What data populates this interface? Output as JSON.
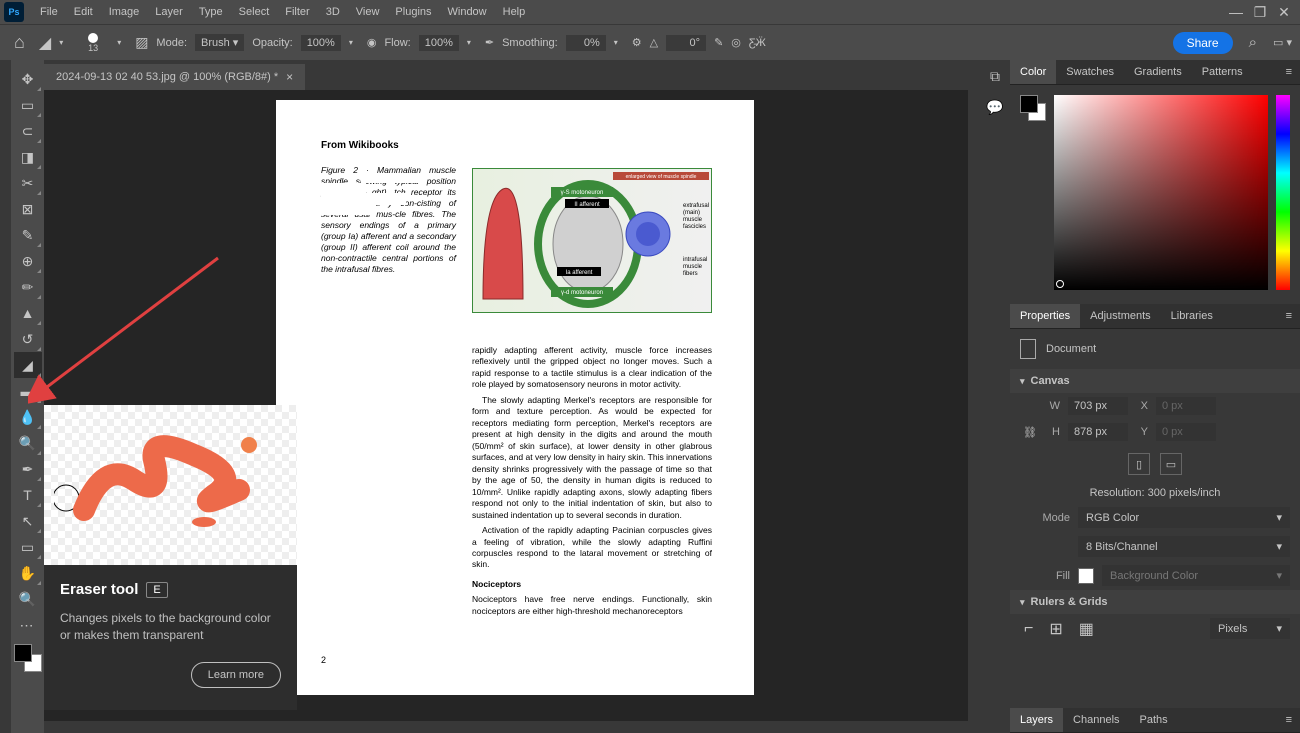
{
  "app": {
    "logo": "Ps"
  },
  "menu": {
    "file": "File",
    "edit": "Edit",
    "image": "Image",
    "layer": "Layer",
    "type": "Type",
    "select": "Select",
    "filter": "Filter",
    "threeD": "3D",
    "view": "View",
    "plugins": "Plugins",
    "window": "Window",
    "help": "Help"
  },
  "opt": {
    "brush_size": "13",
    "mode_label": "Mode:",
    "mode_val": "Brush",
    "opacity_label": "Opacity:",
    "opacity_val": "100%",
    "flow_label": "Flow:",
    "flow_val": "100%",
    "smooth_label": "Smoothing:",
    "smooth_val": "0%",
    "angle_icon": "△",
    "angle_val": "0°",
    "share": "Share"
  },
  "document": {
    "tab_title": "2024-09-13 02 40 53.jpg @ 100% (RGB/8#) *"
  },
  "canvas": {
    "header": "From Wikibooks",
    "fig_caption": "Figure 2 · Mammalian muscle spindle showing typical position pronal con- ght). tch receptor its own motor si y con-cisting of several usal mus-cle fibres. The sensory endings of a primary (group Ia) afferent and a secondary (group II) afferent coil around the non-contractile central portions of the intrafusal fibres.",
    "p1": "rapidly adapting afferent activity, muscle force increases reflexively until the gripped object no longer moves. Such a rapid response to a tactile stimulus is a clear indication of the role played by somatosensory neurons in motor activity.",
    "p2": "The slowly adapting Merkel's receptors are responsible for form and texture perception. As would be expected for receptors mediating form perception, Merkel's receptors are present at high density in the digits and around the mouth (50/mm² of skin surface), at lower density in other glabrous surfaces, and at very low density in hairy skin. This innervations density shrinks progressively with the passage of time so that by the age of 50, the density in human digits is reduced to 10/mm². Unlike rapidly adapting axons, slowly adapting fibers respond not only to the initial indentation of skin, but also to sustained indentation up to several seconds in duration.",
    "p3": "Activation of the rapidly adapting Pacinian corpuscles gives a feeling of vibration, while the slowly adapting Ruffini corpuscles respond to the lataral movement or stretching of skin.",
    "sub": "Nociceptors",
    "p4": "Nociceptors have free nerve endings. Functionally, skin nociceptors are either high-threshold mechanoreceptors",
    "pagenum": "2"
  },
  "right_tabs": {
    "color": "Color",
    "swatches": "Swatches",
    "gradients": "Gradients",
    "patterns": "Patterns"
  },
  "props_tabs": {
    "properties": "Properties",
    "adjustments": "Adjustments",
    "libraries": "Libraries"
  },
  "props": {
    "doc_label": "Document",
    "canvas_label": "Canvas",
    "w_label": "W",
    "w_val": "703 px",
    "x_label": "X",
    "x_val": "0 px",
    "h_label": "H",
    "h_val": "878 px",
    "y_label": "Y",
    "y_val": "0 px",
    "res": "Resolution: 300 pixels/inch",
    "mode_label": "Mode",
    "mode_val": "RGB Color",
    "bits_val": "8 Bits/Channel",
    "fill_label": "Fill",
    "fill_val": "Background Color",
    "rulers_label": "Rulers & Grids",
    "units_val": "Pixels"
  },
  "bottom_tabs": {
    "layers": "Layers",
    "channels": "Channels",
    "paths": "Paths"
  },
  "tooltip": {
    "title": "Eraser tool",
    "key": "E",
    "desc": "Changes pixels to the background color or makes them transparent",
    "learn": "Learn more"
  }
}
